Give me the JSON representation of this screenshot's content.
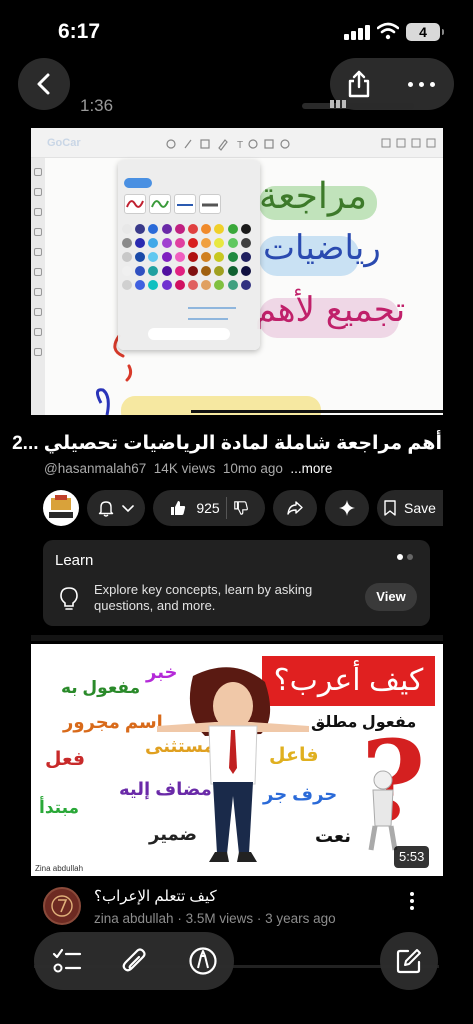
{
  "status_bar": {
    "time": "6:17",
    "battery": "4"
  },
  "player": {
    "duration": "1:36"
  },
  "video1": {
    "title": "أهم مراجعة شاملة لمادة الرياضيات تحصيلي ...2",
    "channel": "@hasanmalah67",
    "views": "14K views",
    "age": "10mo ago",
    "more": "...more",
    "likes": "925",
    "save_label": "Save",
    "thumb_app_name": "GoCar",
    "thumb_words": [
      "مراجعة",
      "رياضيات",
      "تجميع لأهم"
    ]
  },
  "learn_card": {
    "heading": "Learn",
    "description": "Explore key concepts, learn by asking questions, and more.",
    "view_label": "View"
  },
  "video2": {
    "title": "كيف تتعلم الإعراب؟",
    "channel": "zina abdullah",
    "views": "3.5M views",
    "age": "3 years ago",
    "duration": "5:53",
    "thumb_banner": "كيف أعرب؟",
    "thumb_credit": "Zina abdullah",
    "thumb_words": {
      "w1": "خبر",
      "w2": "مفعول به",
      "w3": "اسم مجرور",
      "w4": "فعل",
      "w5": "مستثنى",
      "w6": "مضاف إليه",
      "w7": "مبتدأ",
      "w8": "ضمير",
      "w9": "مفعول مطلق",
      "w10": "فاعل",
      "w11": "حرف جر",
      "w12": "نعت",
      "w13": "?"
    }
  },
  "colors": {
    "background": "#000000",
    "card": "#212121",
    "chip": "#272727",
    "accent_red": "#e02020"
  }
}
